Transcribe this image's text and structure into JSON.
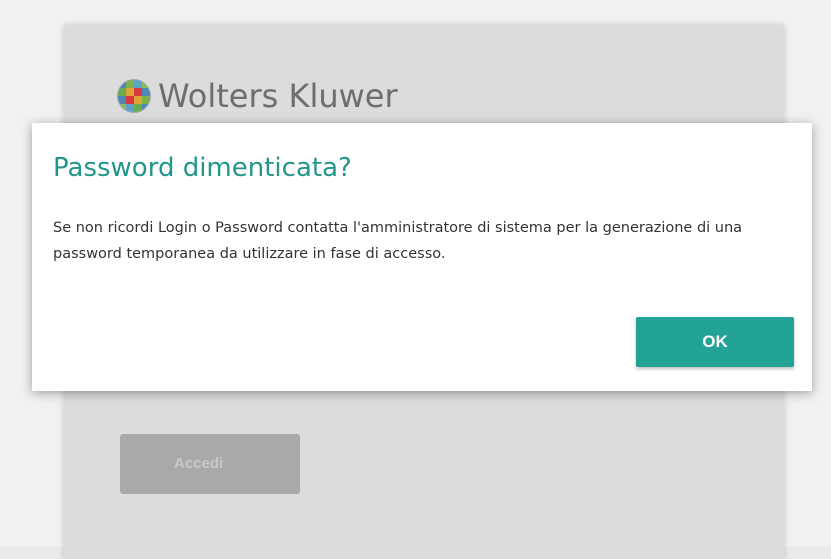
{
  "brand": {
    "name": "Wolters Kluwer",
    "logo_icon": "wolters-kluwer-globe-icon"
  },
  "login": {
    "submit_label": "Accedi"
  },
  "dialog": {
    "title": "Password dimenticata?",
    "message": "Se non ricordi Login o Password contatta l'amministratore di sistema per la generazione di una password temporanea da utilizzare in fase di accesso.",
    "ok_label": "OK"
  },
  "colors": {
    "accent": "#23a296",
    "title": "#23968c",
    "disabled_button": "#a9a9a9"
  }
}
